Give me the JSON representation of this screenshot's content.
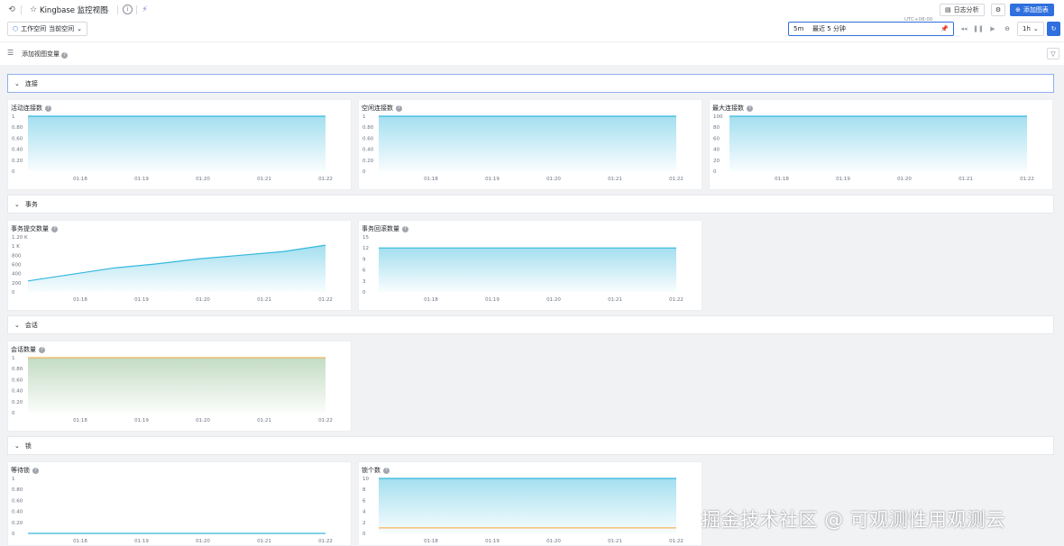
{
  "header": {
    "title": "Kingbase 监控视图",
    "log_analysis": "日志分析",
    "add_chart": "添加图表",
    "workspace_label": "工作空间",
    "workspace_value": "当前空间",
    "time_short": "5m",
    "time_range": "最近 5 分钟",
    "timezone": "UTC+08:00",
    "interval": "1h"
  },
  "variables": {
    "label": "添加视图变量"
  },
  "sections": [
    {
      "title": "连接",
      "panels": [
        {
          "title": "活动连接数",
          "chart_data": {
            "type": "area",
            "x": [
              "01:18",
              "01:19",
              "01:20",
              "01:21",
              "01:22"
            ],
            "yticks": [
              "1",
              "0.80",
              "0.60",
              "0.40",
              "0.20",
              "0"
            ],
            "ylim": [
              0,
              1
            ],
            "series": [
              {
                "values": [
                  1,
                  1,
                  1,
                  1,
                  1
                ],
                "color": "#35b8dd"
              }
            ]
          }
        },
        {
          "title": "空闲连接数",
          "chart_data": {
            "type": "area",
            "x": [
              "01:18",
              "01:19",
              "01:20",
              "01:21",
              "01:22"
            ],
            "yticks": [
              "1",
              "0.80",
              "0.60",
              "0.40",
              "0.20",
              "0"
            ],
            "ylim": [
              0,
              1
            ],
            "series": [
              {
                "values": [
                  1,
                  1,
                  1,
                  1,
                  1
                ],
                "color": "#35b8dd"
              }
            ]
          }
        },
        {
          "title": "最大连接数",
          "chart_data": {
            "type": "area",
            "x": [
              "01:18",
              "01:19",
              "01:20",
              "01:21",
              "01:22"
            ],
            "yticks": [
              "100",
              "80",
              "60",
              "40",
              "20",
              "0"
            ],
            "ylim": [
              0,
              100
            ],
            "series": [
              {
                "values": [
                  100,
                  100,
                  100,
                  100,
                  100
                ],
                "color": "#35b8dd"
              }
            ]
          }
        }
      ]
    },
    {
      "title": "事务",
      "panels": [
        {
          "title": "事务提交数量",
          "chart_data": {
            "type": "area",
            "x": [
              "01:18",
              "01:19",
              "01:20",
              "01:21",
              "01:22"
            ],
            "yticks": [
              "1.20 K",
              "1 K",
              "800",
              "600",
              "400",
              "200",
              "0"
            ],
            "ylim": [
              0,
              1200
            ],
            "series": [
              {
                "values": [
                  240,
                  380,
                  520,
                  610,
                  720,
                  800,
                  880,
                  1020
                ],
                "color": "#35b8dd"
              }
            ]
          }
        },
        {
          "title": "事务回滚数量",
          "chart_data": {
            "type": "area",
            "x": [
              "01:18",
              "01:19",
              "01:20",
              "01:21",
              "01:22"
            ],
            "yticks": [
              "15",
              "12",
              "9",
              "6",
              "3",
              "0"
            ],
            "ylim": [
              0,
              15
            ],
            "series": [
              {
                "values": [
                  12,
                  12,
                  12,
                  12,
                  12
                ],
                "color": "#35b8dd"
              }
            ]
          }
        }
      ]
    },
    {
      "title": "会话",
      "panels": [
        {
          "title": "会话数量",
          "chart_data": {
            "type": "area",
            "x": [
              "01:18",
              "01:19",
              "01:20",
              "01:21",
              "01:22"
            ],
            "yticks": [
              "1",
              "0.80",
              "0.60",
              "0.40",
              "0.20",
              "0"
            ],
            "ylim": [
              0,
              1
            ],
            "series": [
              {
                "values": [
                  1,
                  1,
                  1,
                  1,
                  1
                ],
                "color": "#f5b45a",
                "fill": "#7ab07a"
              }
            ]
          }
        }
      ]
    },
    {
      "title": "锁",
      "panels": [
        {
          "title": "等待锁",
          "chart_data": {
            "type": "line",
            "x": [
              "01:18",
              "01:19",
              "01:20",
              "01:21",
              "01:22"
            ],
            "yticks": [
              "1",
              "0.80",
              "0.60",
              "0.40",
              "0.20",
              "0"
            ],
            "ylim": [
              0,
              1
            ],
            "series": [
              {
                "values": [
                  0,
                  0,
                  0,
                  0,
                  0
                ],
                "color": "#35b8dd"
              }
            ]
          }
        },
        {
          "title": "锁个数",
          "chart_data": {
            "type": "area",
            "x": [
              "01:18",
              "01:19",
              "01:20",
              "01:21",
              "01:22"
            ],
            "yticks": [
              "10",
              "8",
              "6",
              "4",
              "2",
              "0"
            ],
            "ylim": [
              0,
              10
            ],
            "series": [
              {
                "values": [
                  10,
                  10,
                  10,
                  10,
                  10
                ],
                "color": "#35b8dd"
              },
              {
                "values": [
                  1,
                  1,
                  1,
                  1,
                  1
                ],
                "color": "#f5b45a"
              }
            ]
          }
        }
      ]
    }
  ],
  "watermark": "掘金技术社区 @ 可观测性用观测云"
}
